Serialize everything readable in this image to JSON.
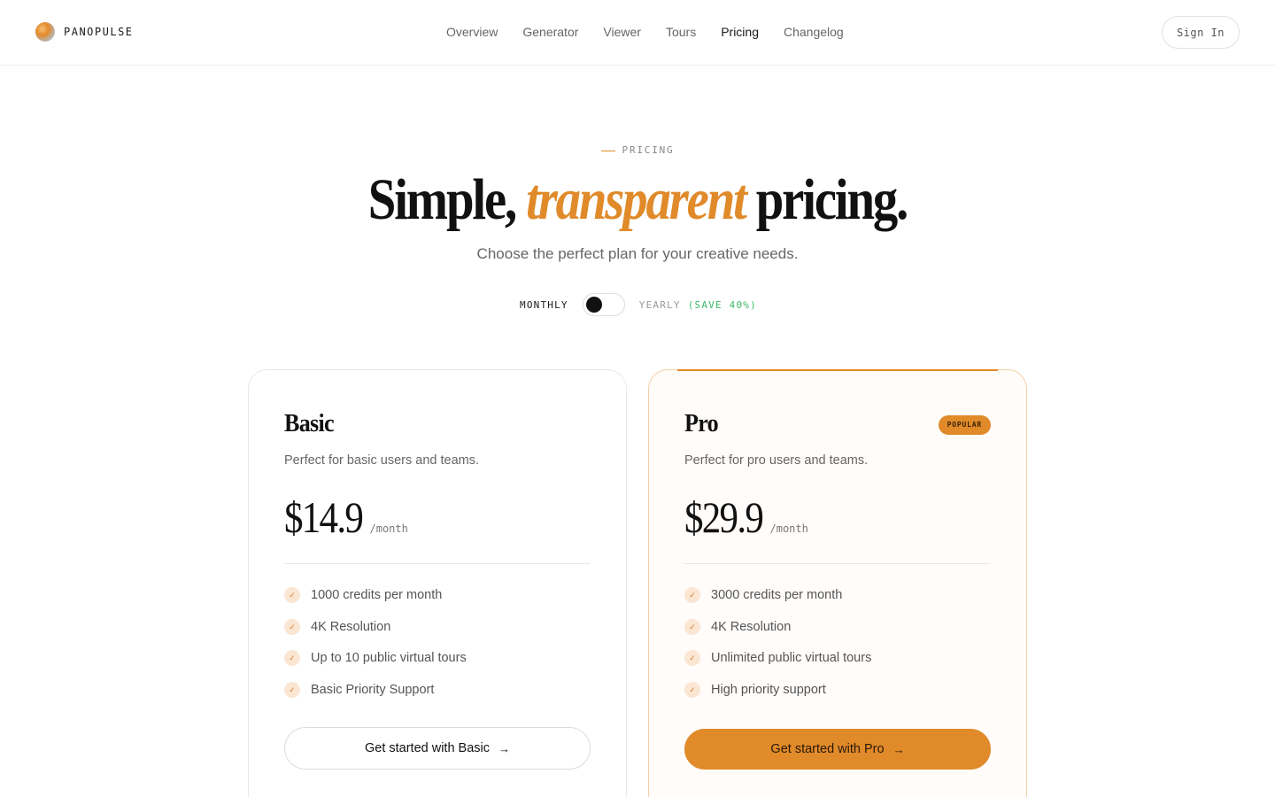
{
  "header": {
    "brand": "PANOPULSE",
    "nav": [
      {
        "label": "Overview",
        "active": false
      },
      {
        "label": "Generator",
        "active": false
      },
      {
        "label": "Viewer",
        "active": false
      },
      {
        "label": "Tours",
        "active": false
      },
      {
        "label": "Pricing",
        "active": true
      },
      {
        "label": "Changelog",
        "active": false
      }
    ],
    "sign_in": "Sign In"
  },
  "hero": {
    "eyebrow": "PRICING",
    "title_before": "Simple, ",
    "title_accent": "transparent",
    "title_after": " pricing.",
    "subtitle": "Choose the perfect plan for your creative needs."
  },
  "billing": {
    "monthly_label": "MONTHLY",
    "yearly_label": "YEARLY",
    "save_label": "(SAVE 40%)",
    "selected": "monthly"
  },
  "plans": [
    {
      "name": "Basic",
      "description": "Perfect for basic users and teams.",
      "price": "$14.9",
      "period": "/month",
      "features": [
        "1000 credits per month",
        "4K Resolution",
        "Up to 10 public virtual tours",
        "Basic Priority Support"
      ],
      "cta": "Get started with Basic"
    },
    {
      "name": "Pro",
      "badge": "POPULAR",
      "description": "Perfect for pro users and teams.",
      "price": "$29.9",
      "period": "/month",
      "features": [
        "3000 credits per month",
        "4K Resolution",
        "Unlimited public virtual tours",
        "High priority support"
      ],
      "cta": "Get started with Pro"
    }
  ],
  "icons": {
    "check": "check-icon",
    "arrow": "arrow-right-icon"
  },
  "colors": {
    "accent": "#e08a2a",
    "save": "#3fba6a",
    "text": "#111111",
    "muted": "#666666"
  }
}
